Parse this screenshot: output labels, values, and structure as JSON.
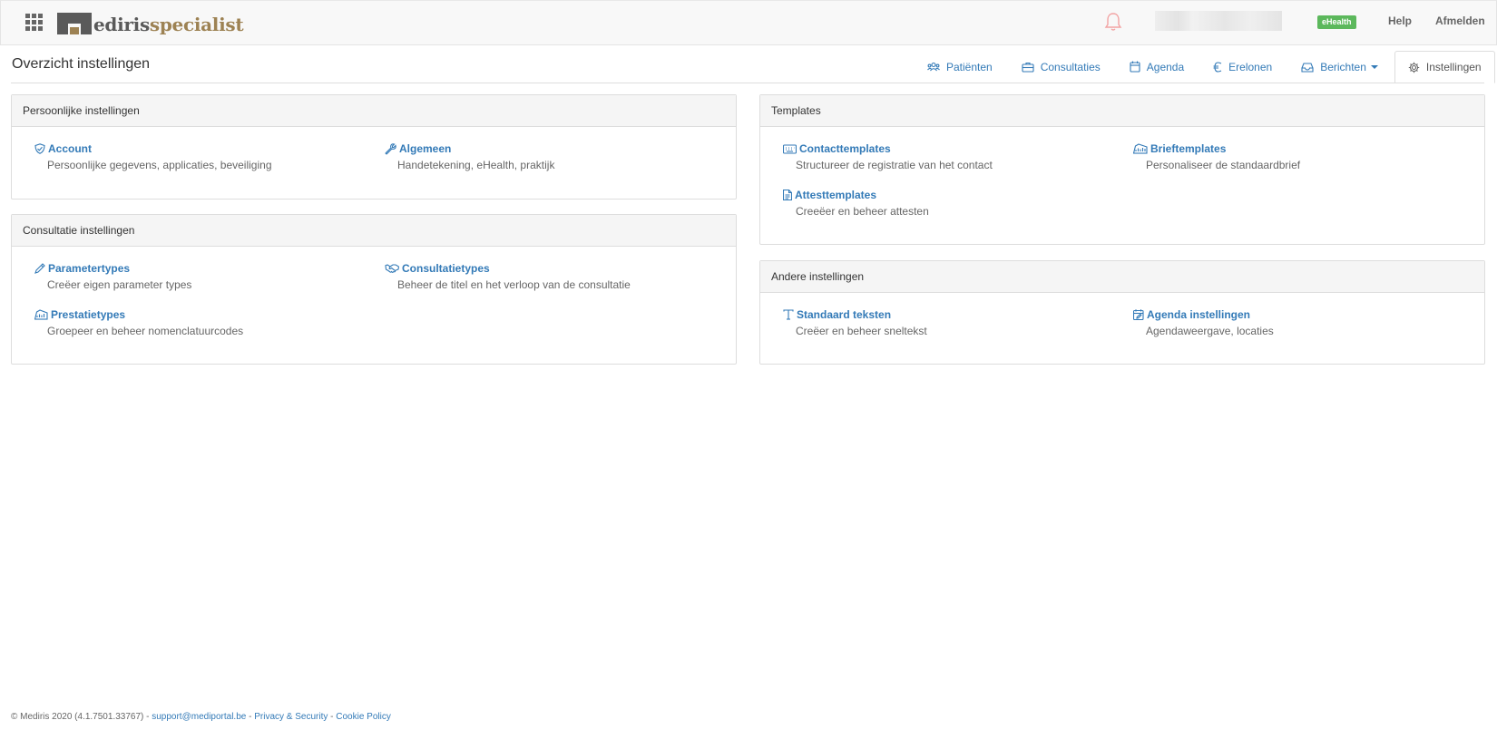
{
  "topbar": {
    "logo": {
      "part1": "ediris",
      "part2": "specialist"
    },
    "ehealth_badge": "eHealth",
    "help_label": "Help",
    "logout_label": "Afmelden"
  },
  "header": {
    "title": "Overzicht instellingen",
    "tabs": [
      {
        "label": "Patiënten",
        "icon": "users-icon"
      },
      {
        "label": "Consultaties",
        "icon": "briefcase-icon"
      },
      {
        "label": "Agenda",
        "icon": "calendar-icon"
      },
      {
        "label": "Erelonen",
        "icon": "euro-icon"
      },
      {
        "label": "Berichten",
        "icon": "inbox-icon"
      },
      {
        "label": "Instellingen",
        "icon": "gear-icon"
      }
    ]
  },
  "panels": {
    "personal": {
      "heading": "Persoonlijke instellingen",
      "items": [
        {
          "title": "Account",
          "desc": "Persoonlijke gegevens, applicaties, beveiliging",
          "icon": "shield-icon"
        },
        {
          "title": "Algemeen",
          "desc": "Handetekening, eHealth, praktijk",
          "icon": "wrench-icon"
        }
      ]
    },
    "templates": {
      "heading": "Templates",
      "items": [
        {
          "title": "Contacttemplates",
          "desc": "Structureer de registratie van het contact",
          "icon": "keyboard-icon"
        },
        {
          "title": "Brieftemplates",
          "desc": "Personaliseer de standaardbrief",
          "icon": "envelope-icon"
        },
        {
          "title": "Attesttemplates",
          "desc": "Creeëer en beheer attesten",
          "icon": "document-icon"
        }
      ]
    },
    "consult": {
      "heading": "Consultatie instellingen",
      "items": [
        {
          "title": "Parametertypes",
          "desc": "Creëer eigen parameter types",
          "icon": "pencil-icon"
        },
        {
          "title": "Consultatietypes",
          "desc": "Beheer de titel en het verloop van de consultatie",
          "icon": "handshake-icon"
        },
        {
          "title": "Prestatietypes",
          "desc": "Groepeer en beheer nomenclatuurcodes",
          "icon": "chart-icon"
        }
      ]
    },
    "other": {
      "heading": "Andere instellingen",
      "items": [
        {
          "title": "Standaard teksten",
          "desc": "Creëer en beheer sneltekst",
          "icon": "text-icon"
        },
        {
          "title": "Agenda instellingen",
          "desc": "Agendaweergave, locaties",
          "icon": "calendar-edit-icon"
        }
      ]
    }
  },
  "footer": {
    "copyright": "© Mediris 2020 (4.1.7501.33767) - ",
    "support_email": "support@mediportal.be",
    "sep1": " - ",
    "privacy": "Privacy & Security",
    "sep2": " - ",
    "cookie": "Cookie Policy"
  },
  "colors": {
    "link": "#337ab7",
    "badge": "#5cb85c",
    "logo_gold": "#9d8253"
  }
}
